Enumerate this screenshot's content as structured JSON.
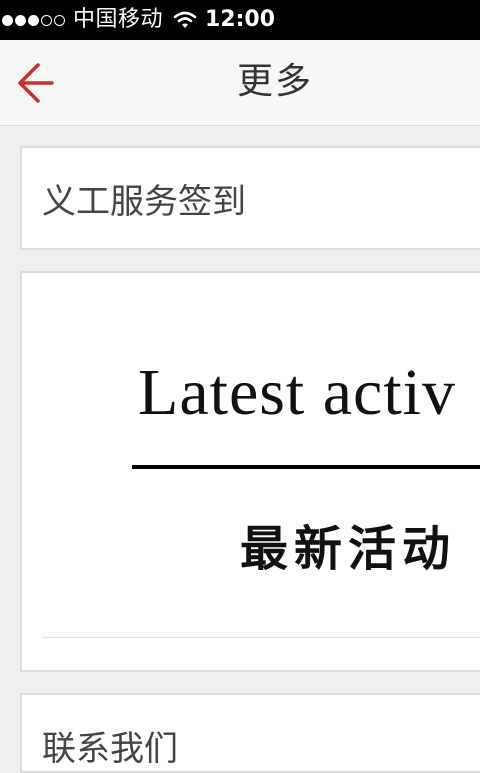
{
  "status_bar": {
    "carrier": "中国移动",
    "time": "12:00",
    "signal_filled": 3,
    "signal_total": 5
  },
  "nav": {
    "title": "更多",
    "accent_color": "#c8312f"
  },
  "items": [
    {
      "label": "义工服务签到"
    },
    {
      "banner_en": "Latest activ",
      "banner_zh": "最新活动"
    },
    {
      "label": "联系我们"
    }
  ]
}
